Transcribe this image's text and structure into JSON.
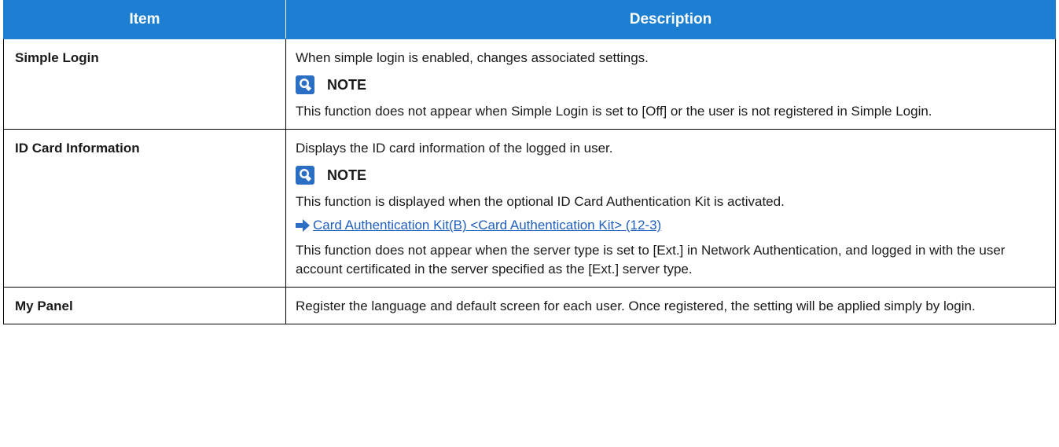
{
  "table": {
    "headers": {
      "item": "Item",
      "description": "Description"
    },
    "rows": [
      {
        "item": "Simple Login",
        "desc1": "When simple login is enabled, changes associated settings.",
        "note_label": "NOTE",
        "note_text": "This function does not appear when Simple Login is set to [Off] or the user is not registered in Simple Login."
      },
      {
        "item": "ID Card Information",
        "desc1": "Displays the ID card information of the logged in user.",
        "note_label": "NOTE",
        "note_text": "This function is displayed when the optional ID Card Authentication Kit is activated.",
        "link_text": "Card Authentication Kit(B) <Card Authentication Kit> (12-3)",
        "desc2": "This function does not appear when the server type is set to [Ext.] in Network Authentication, and logged in with the user account certificated in the server specified as the [Ext.] server type."
      },
      {
        "item": "My Panel",
        "desc1": "Register the language and default screen for each user. Once registered, the setting will be applied simply by login."
      }
    ]
  },
  "colors": {
    "header_bg": "#1d7fd1",
    "link": "#1f5fbf",
    "icon": "#2a6fc4"
  },
  "icons": {
    "note": "note-bulb-icon",
    "link": "arrow-right-icon"
  }
}
